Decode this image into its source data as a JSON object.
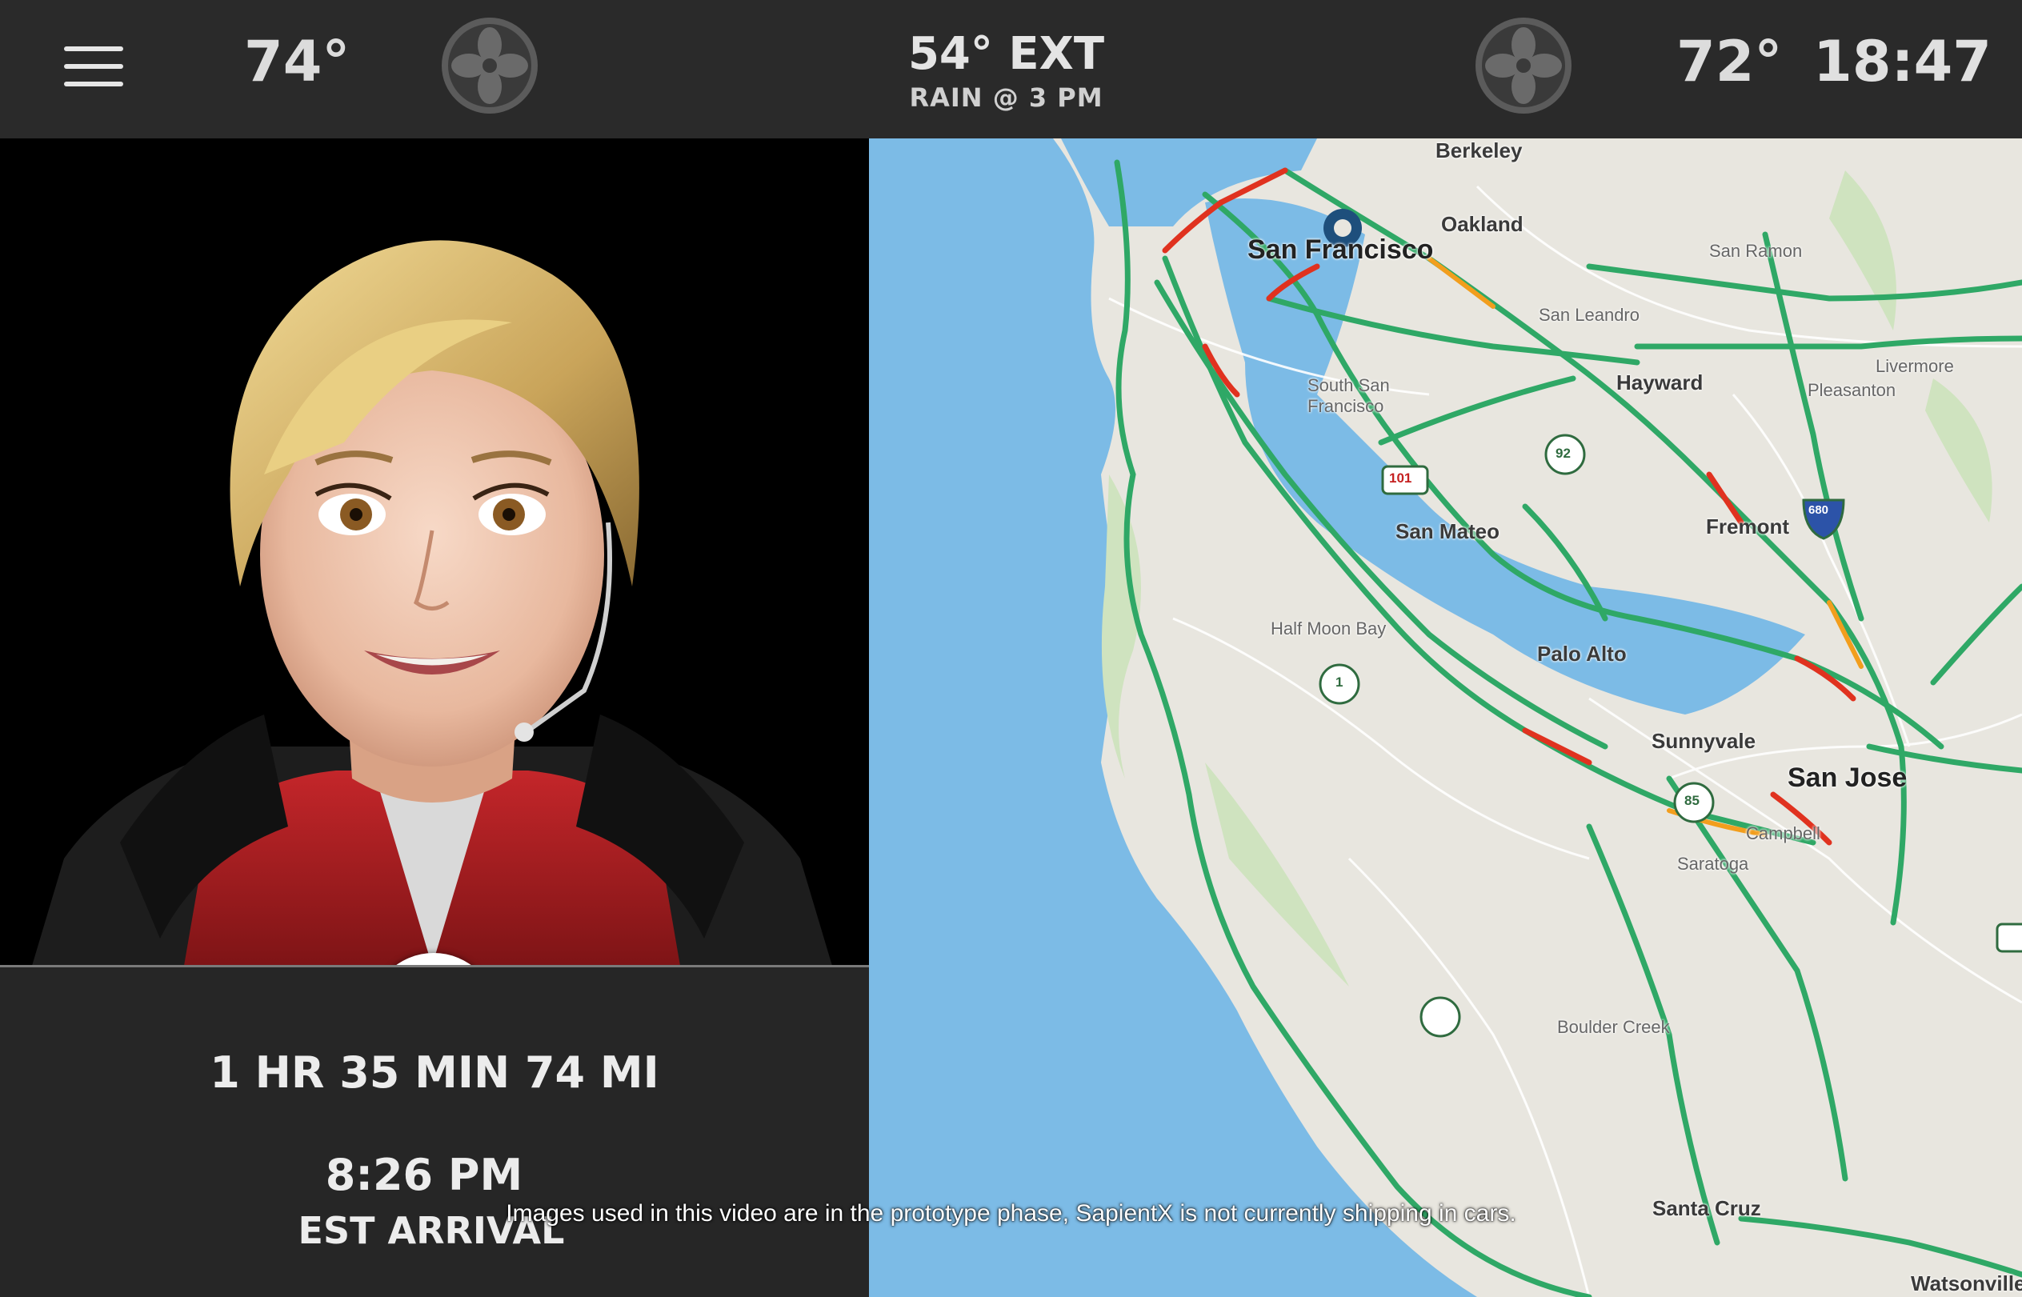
{
  "header": {
    "menu_icon": "hamburger-menu-icon",
    "driver_temp": "74°",
    "passenger_temp": "72°",
    "fan_icon": "fan-icon",
    "exterior_temp": "54° EXT",
    "forecast": "RAIN @ 3 PM",
    "clock": "18:47"
  },
  "assistant": {
    "close_icon": "close-icon",
    "close_color": "#b31b1b"
  },
  "trip": {
    "duration_distance": "1 HR 35 MIN  74 MI",
    "arrival_time": "8:26 PM",
    "arrival_label": "EST ARRIVAL"
  },
  "map": {
    "water_color": "#7cbbe6",
    "land_color": "#e8e6df",
    "traffic_green": "#2fa866",
    "traffic_red": "#e0321f",
    "labels": {
      "berkeley": "Berkeley",
      "san_francisco": "San Francisco",
      "oakland": "Oakland",
      "san_ramon": "San Ramon",
      "san_leandro": "San Leandro",
      "hayward": "Hayward",
      "pleasanton": "Pleasanton",
      "livermore": "Livermore",
      "south_sf": "South San Francisco",
      "san_mateo": "San Mateo",
      "fremont": "Fremont",
      "half_moon_bay": "Half Moon Bay",
      "palo_alto": "Palo Alto",
      "sunnyvale": "Sunnyvale",
      "san_jose": "San Jose",
      "campbell": "Campbell",
      "saratoga": "Saratoga",
      "boulder_creek": "Boulder Creek",
      "santa_cruz": "Santa Cruz",
      "watsonville": "Watsonville"
    },
    "shields": [
      "101",
      "92",
      "680",
      "85",
      "1"
    ]
  },
  "caption": "Images used in this video are in the prototype phase, SapientX is not currently shipping in cars."
}
